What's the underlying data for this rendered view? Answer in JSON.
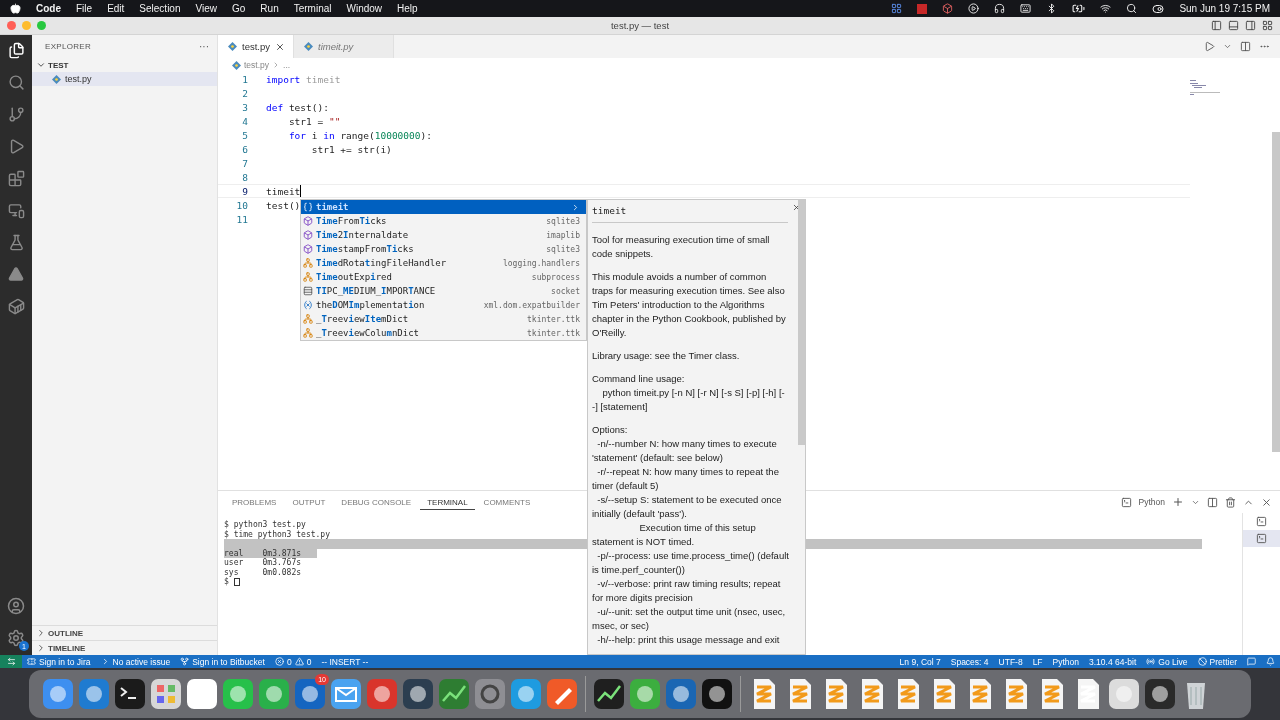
{
  "menubar": {
    "app": "Code",
    "menus": [
      "File",
      "Edit",
      "Selection",
      "View",
      "Go",
      "Run",
      "Terminal",
      "Window",
      "Help"
    ],
    "clock": "Sun Jun 19  7:15 PM"
  },
  "window": {
    "title": "test.py — test"
  },
  "activity_bar": {
    "settings_badge": "1"
  },
  "sidebar": {
    "title": "EXPLORER",
    "more": "···",
    "folder": {
      "label": "TEST",
      "expanded": true,
      "children": [
        {
          "label": "test.py",
          "selected": true
        }
      ]
    },
    "sections": [
      {
        "label": "OUTLINE",
        "expanded": false
      },
      {
        "label": "TIMELINE",
        "expanded": false
      }
    ]
  },
  "tabs": [
    {
      "label": "test.py",
      "selected": true,
      "preview": false
    },
    {
      "label": "timeit.py",
      "selected": false,
      "preview": true
    }
  ],
  "breadcrumb": [
    "test.py",
    "..."
  ],
  "editor": {
    "lines": [
      {
        "number": "1",
        "current": false,
        "tokens": [
          {
            "text": "import",
            "kind": "keyword"
          },
          {
            "text": " timeit",
            "kind": "dimmed"
          }
        ]
      },
      {
        "number": "2",
        "current": false
      },
      {
        "number": "3",
        "current": false,
        "tokens": [
          {
            "text": "def",
            "kind": "keyword"
          },
          {
            "text": " test():",
            "kind": "plain"
          }
        ]
      },
      {
        "number": "4",
        "current": false,
        "tokens": [
          {
            "text": "    str1 = ",
            "kind": "plain"
          },
          {
            "text": "\"\"",
            "kind": "string"
          }
        ]
      },
      {
        "number": "5",
        "current": false,
        "tokens": [
          {
            "text": "    for",
            "kind": "keyword"
          },
          {
            "text": " i ",
            "kind": "plain"
          },
          {
            "text": "in",
            "kind": "keyword"
          },
          {
            "text": " range(",
            "kind": "plain"
          },
          {
            "text": "10000000",
            "kind": "number"
          },
          {
            "text": "):",
            "kind": "plain"
          }
        ]
      },
      {
        "number": "6",
        "current": false,
        "tokens": [
          {
            "text": "        str1 += str(i)",
            "kind": "plain"
          }
        ]
      },
      {
        "number": "7",
        "current": false
      },
      {
        "number": "8",
        "current": false
      },
      {
        "number": "9",
        "current": true,
        "tokens": [
          {
            "text": "timeit",
            "kind": "plain"
          }
        ]
      },
      {
        "number": "10",
        "current": false,
        "tokens": [
          {
            "text": "test()",
            "kind": "plain"
          }
        ]
      },
      {
        "number": "11",
        "current": false
      }
    ]
  },
  "suggest": {
    "items": [
      {
        "label": "**timeit**",
        "kind": "module",
        "selected": true
      },
      {
        "label": "**Time**From**Ti**cks",
        "detail": "sqlite3",
        "kind": "method",
        "selected": false
      },
      {
        "label": "**Time**2**I**nternaldate",
        "detail": "imaplib",
        "kind": "method",
        "selected": false
      },
      {
        "label": "**Time**stampFrom**Ti**cks",
        "detail": "sqlite3",
        "kind": "method",
        "selected": false
      },
      {
        "label": "**Time**dRota**t**ingFileHandler",
        "detail": "logging.handlers",
        "kind": "class",
        "selected": false
      },
      {
        "label": "**Time**outExp**i**red",
        "detail": "subprocess",
        "kind": "class",
        "selected": false
      },
      {
        "label": "**TI**PC_**ME**DIUM_**I**MPOR**T**ANCE",
        "detail": "socket",
        "kind": "constant",
        "selected": false
      },
      {
        "label": "the**D**OM**Im**plementat**i**on",
        "detail": "xml.dom.expatbuilder",
        "kind": "variable",
        "selected": false
      },
      {
        "label": "_**T**reev**i**ew**Ite**mDict",
        "detail": "tkinter.ttk",
        "kind": "class",
        "selected": false
      },
      {
        "label": "_**T**reev**i**ewColu**m**nDict",
        "detail": "tkinter.ttk",
        "kind": "class",
        "selected": false
      }
    ]
  },
  "docs": {
    "title": "timeit",
    "paragraphs": [
      "Tool for measuring execution time of small code snippets.",
      "This module avoids a number of common traps for measuring execution times. See also Tim Peters' introduction to the Algorithms chapter in the Python Cookbook, published by O'Reilly.",
      "Library usage: see the Timer class.",
      "Command line usage:\n    python timeit.py [-n N] [-r N] [-s S] [-p] [-h] [--] [statement]",
      "Options:\n  -n/--number N: how many times to execute 'statement' (default: see below)\n  -r/--repeat N: how many times to repeat the timer (default 5)\n  -s/--setup S: statement to be executed once initially (default 'pass').\n                  Execution time of this setup statement is NOT timed.\n  -p/--process: use time.process_time() (default is time.perf_counter())\n  -v/--verbose: print raw timing results; repeat for more digits precision\n  -u/--unit: set the output time unit (nsec, usec, msec, or sec)\n  -h/--help: print this usage message and exit"
    ]
  },
  "panel": {
    "tabs": [
      {
        "label": "PROBLEMS",
        "selected": false
      },
      {
        "label": "OUTPUT",
        "selected": false
      },
      {
        "label": "DEBUG CONSOLE",
        "selected": false
      },
      {
        "label": "TERMINAL",
        "selected": true
      },
      {
        "label": "COMMENTS",
        "selected": false
      }
    ],
    "profile": "Python",
    "terminal": [
      {
        "text": "$ python3 test.py",
        "selected": false
      },
      {
        "text": "$ time python3 test.py",
        "selected": false
      },
      {
        "selected": true
      },
      {
        "text": "real\t0m3.871s",
        "selected": true
      },
      {
        "text": "user\t0m3.767s",
        "selected": false
      },
      {
        "text": "sys\t0m0.082s",
        "selected": false
      },
      {
        "text": "$ ",
        "selected": false,
        "cursor": true
      }
    ],
    "terminals": [
      {
        "selected": false
      },
      {
        "selected": true
      }
    ]
  },
  "status_bar": {
    "left": [
      {
        "text": "Sign in to Jira",
        "kind": "jira"
      },
      {
        "text": "No active issue",
        "kind": "issue"
      },
      {
        "text": "Sign in to Bitbucket",
        "kind": "bitbucket"
      },
      {
        "kind": "problems",
        "errors": "0",
        "warnings": "0"
      },
      {
        "text": "-- INSERT --",
        "kind": "plain"
      }
    ],
    "right": [
      {
        "text": "Ln 9, Col 7",
        "kind": "plain"
      },
      {
        "text": "Spaces: 4",
        "kind": "plain"
      },
      {
        "text": "UTF-8",
        "kind": "plain"
      },
      {
        "text": "LF",
        "kind": "plain"
      },
      {
        "text": "Python",
        "kind": "plain"
      },
      {
        "text": "3.10.4 64-bit",
        "kind": "plain"
      },
      {
        "text": "Go Live",
        "kind": "live"
      },
      {
        "text": "Prettier",
        "kind": "prettier"
      }
    ]
  },
  "dock": {
    "badge": "10"
  }
}
